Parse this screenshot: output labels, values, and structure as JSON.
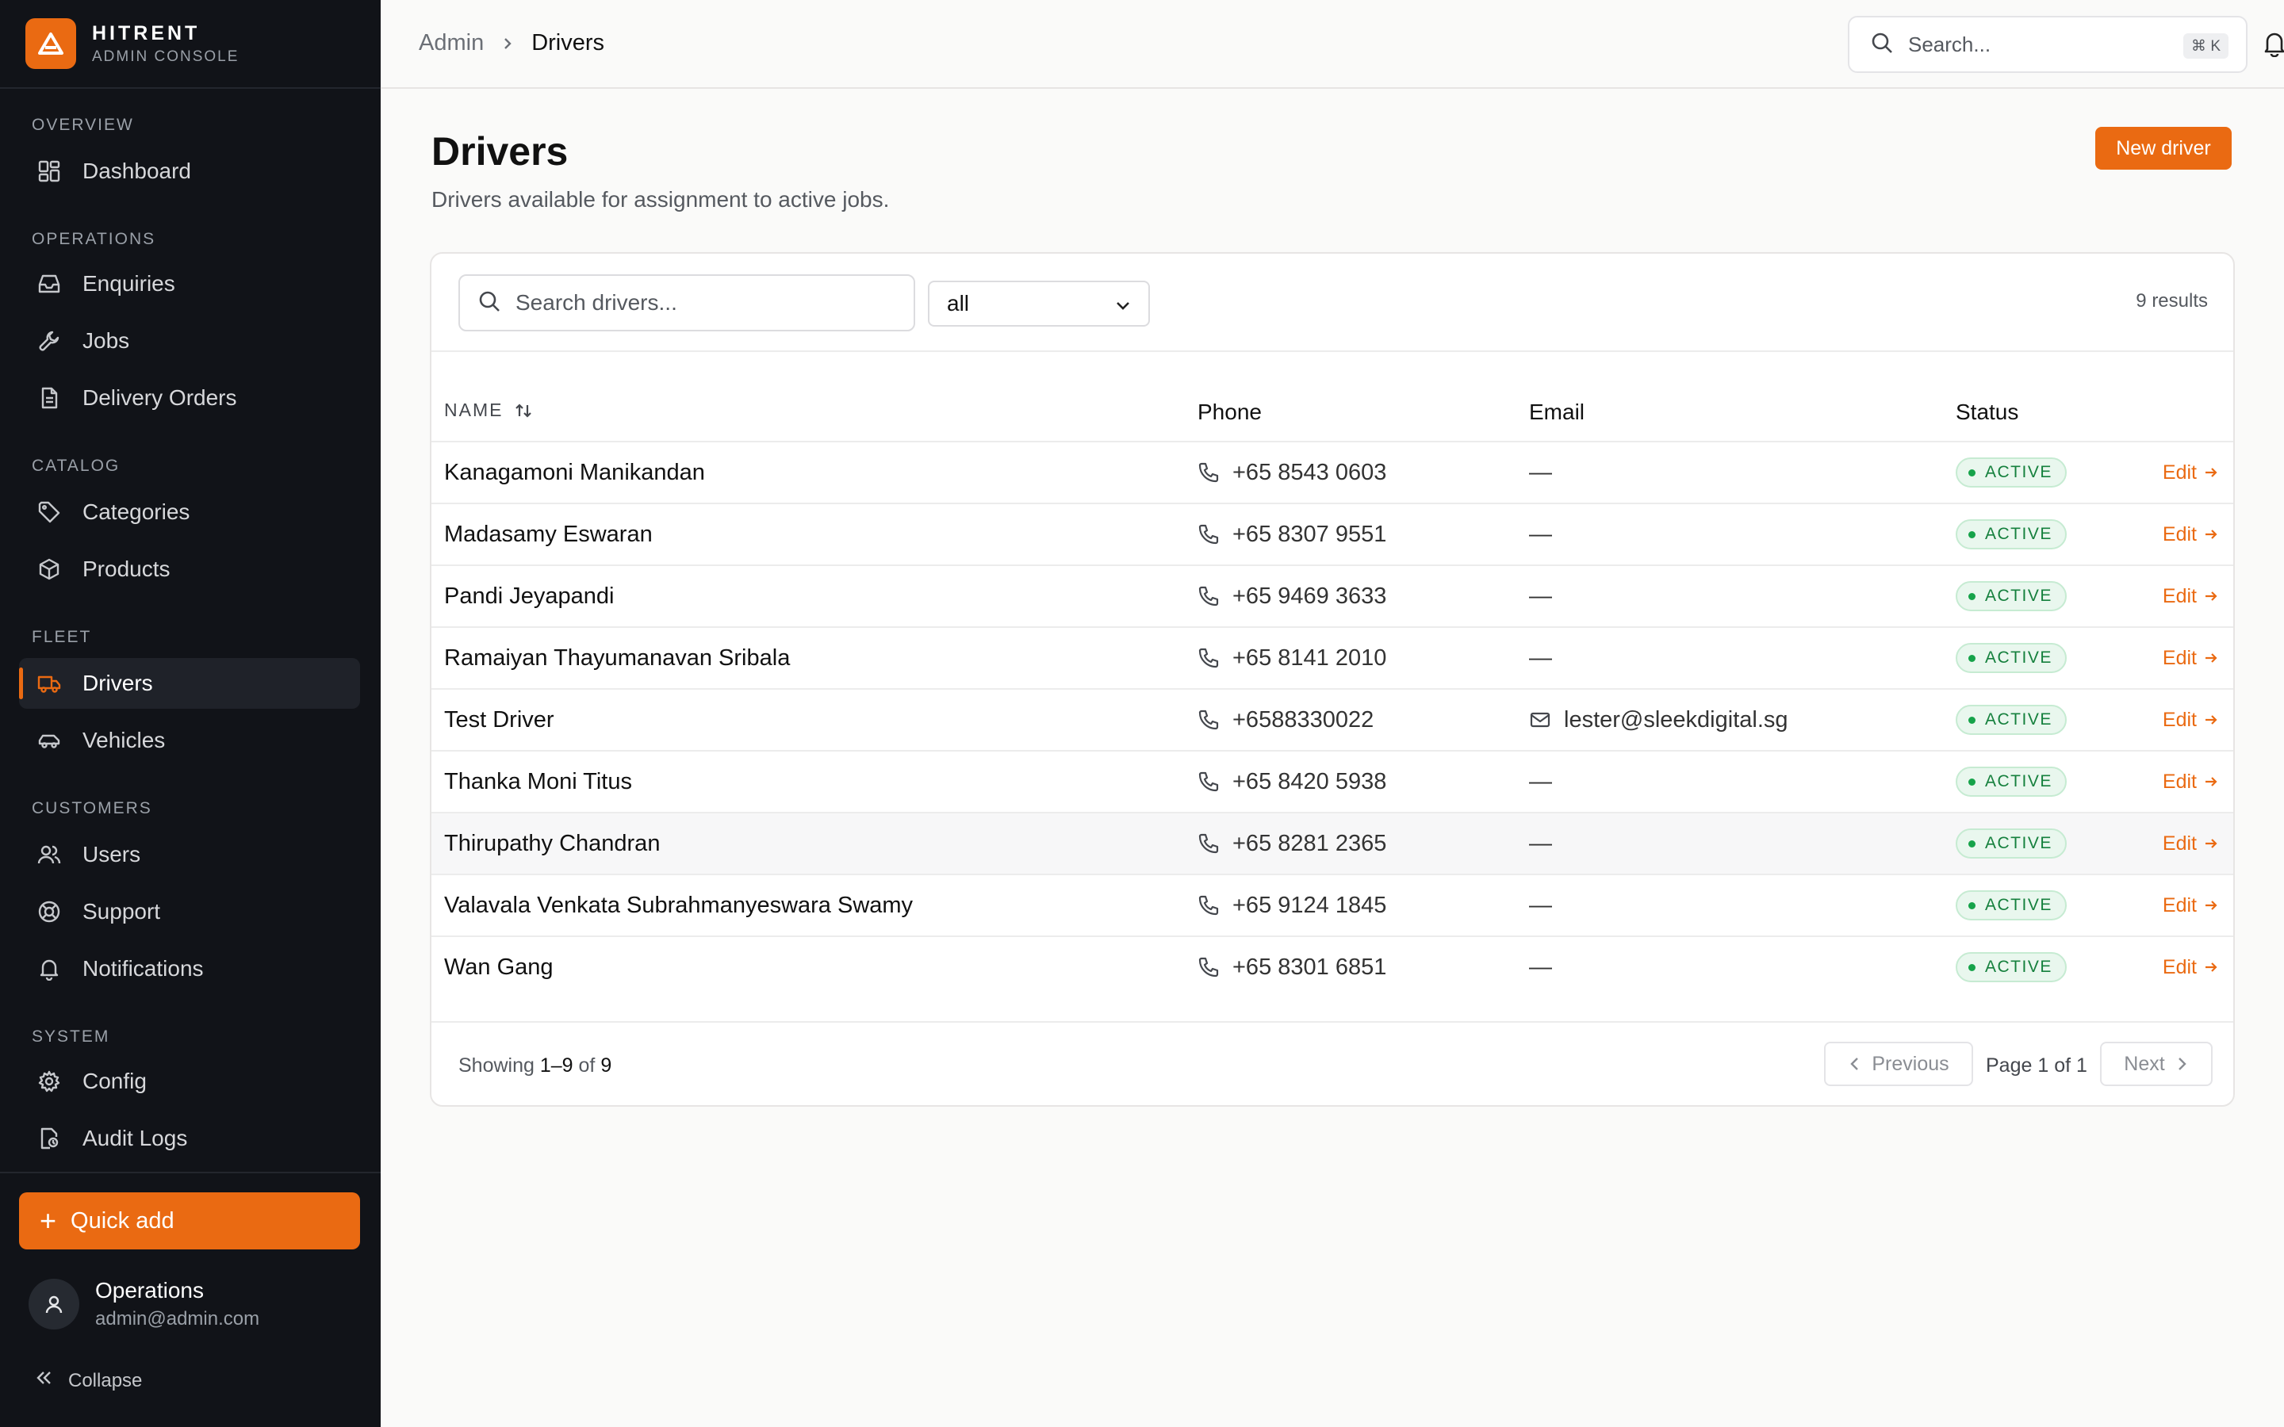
{
  "brand": {
    "name": "HITRENT",
    "subtitle": "ADMIN CONSOLE",
    "accent": "#ea6a12"
  },
  "sidebar": {
    "sections": [
      {
        "label": "OVERVIEW",
        "items": [
          {
            "label": "Dashboard",
            "icon": "dashboard-icon"
          }
        ]
      },
      {
        "label": "OPERATIONS",
        "items": [
          {
            "label": "Enquiries",
            "icon": "inbox-icon"
          },
          {
            "label": "Jobs",
            "icon": "wrench-icon"
          },
          {
            "label": "Delivery Orders",
            "icon": "document-icon"
          }
        ]
      },
      {
        "label": "CATALOG",
        "items": [
          {
            "label": "Categories",
            "icon": "tag-icon"
          },
          {
            "label": "Products",
            "icon": "box-icon"
          }
        ]
      },
      {
        "label": "FLEET",
        "items": [
          {
            "label": "Drivers",
            "icon": "truck-icon",
            "active": true
          },
          {
            "label": "Vehicles",
            "icon": "car-icon"
          }
        ]
      },
      {
        "label": "CUSTOMERS",
        "items": [
          {
            "label": "Users",
            "icon": "users-icon"
          },
          {
            "label": "Support",
            "icon": "lifebuoy-icon"
          },
          {
            "label": "Notifications",
            "icon": "bell-icon"
          }
        ]
      },
      {
        "label": "SYSTEM",
        "items": [
          {
            "label": "Config",
            "icon": "gear-icon"
          },
          {
            "label": "Audit Logs",
            "icon": "audit-icon"
          }
        ]
      }
    ],
    "quick_add_label": "Quick add",
    "user": {
      "name": "Operations",
      "email": "admin@admin.com"
    },
    "collapse_label": "Collapse"
  },
  "topbar": {
    "breadcrumb": {
      "root": "Admin",
      "current": "Drivers"
    },
    "search_placeholder": "Search...",
    "search_shortcut": "⌘ K"
  },
  "page": {
    "title": "Drivers",
    "subtitle": "Drivers available for assignment to active jobs.",
    "new_button": "New driver"
  },
  "table": {
    "search_placeholder": "Search drivers...",
    "filter_value": "all",
    "result_count": "9 results",
    "columns": {
      "name": "NAME",
      "phone": "Phone",
      "email": "Email",
      "status": "Status"
    },
    "action_label": "Edit",
    "status_color": "#15803d",
    "rows": [
      {
        "name": "Kanagamoni Manikandan",
        "phone": "+65 8543 0603",
        "email": "—",
        "status": "ACTIVE"
      },
      {
        "name": "Madasamy Eswaran",
        "phone": "+65 8307 9551",
        "email": "—",
        "status": "ACTIVE"
      },
      {
        "name": "Pandi Jeyapandi",
        "phone": "+65 9469 3633",
        "email": "—",
        "status": "ACTIVE"
      },
      {
        "name": "Ramaiyan Thayumanavan Sribala",
        "phone": "+65 8141 2010",
        "email": "—",
        "status": "ACTIVE"
      },
      {
        "name": "Test Driver",
        "phone": "+6588330022",
        "email": "lester@sleekdigital.sg",
        "status": "ACTIVE"
      },
      {
        "name": "Thanka Moni Titus",
        "phone": "+65 8420 5938",
        "email": "—",
        "status": "ACTIVE"
      },
      {
        "name": "Thirupathy Chandran",
        "phone": "+65 8281 2365",
        "email": "—",
        "status": "ACTIVE"
      },
      {
        "name": "Valavala Venkata Subrahmanyeswara Swamy",
        "phone": "+65 9124 1845",
        "email": "—",
        "status": "ACTIVE"
      },
      {
        "name": "Wan Gang",
        "phone": "+65 8301 6851",
        "email": "—",
        "status": "ACTIVE"
      }
    ],
    "footer": {
      "showing_prefix": "Showing",
      "showing_range": "1–9",
      "showing_of": "of",
      "showing_total": "9",
      "previous": "Previous",
      "page_prefix": "Page",
      "page_current": "1",
      "page_of": "of",
      "page_total": "1",
      "next": "Next"
    }
  }
}
